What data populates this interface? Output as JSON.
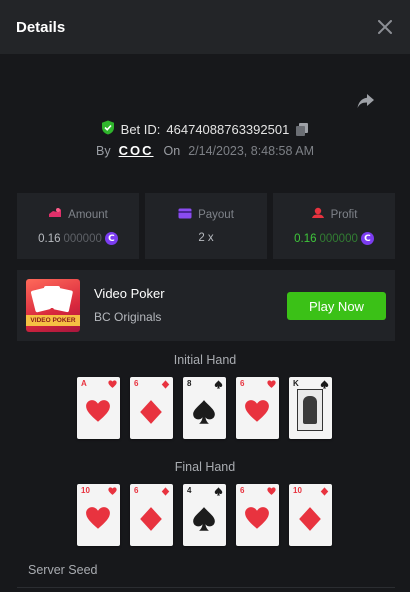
{
  "header": {
    "title": "Details"
  },
  "bet": {
    "label": "Bet ID:",
    "id": "46474088763392501",
    "by_label": "By",
    "user": "COC",
    "on_label": "On",
    "date": "2/14/2023, 8:48:58 AM"
  },
  "stats": {
    "amount": {
      "label": "Amount",
      "value_main": "0.16",
      "value_dim": "000000"
    },
    "payout": {
      "label": "Payout",
      "value": "2 x"
    },
    "profit": {
      "label": "Profit",
      "value_main": "0.16",
      "value_dim": "000000"
    }
  },
  "game": {
    "name": "Video Poker",
    "provider": "BC Originals",
    "play_label": "Play Now",
    "thumb_text": "VIDEO POKER"
  },
  "initial_hand": {
    "label": "Initial Hand",
    "cards": [
      {
        "rank": "A",
        "suit": "hearts"
      },
      {
        "rank": "6",
        "suit": "diamonds"
      },
      {
        "rank": "8",
        "suit": "spades"
      },
      {
        "rank": "6",
        "suit": "hearts"
      },
      {
        "rank": "K",
        "suit": "spades"
      }
    ]
  },
  "final_hand": {
    "label": "Final Hand",
    "cards": [
      {
        "rank": "10",
        "suit": "hearts"
      },
      {
        "rank": "6",
        "suit": "diamonds"
      },
      {
        "rank": "4",
        "suit": "spades"
      },
      {
        "rank": "6",
        "suit": "hearts"
      },
      {
        "rank": "10",
        "suit": "diamonds"
      }
    ]
  },
  "server_seed": {
    "label": "Server Seed"
  },
  "colors": {
    "accent_green": "#3bc117",
    "profit_green": "#3fc63b",
    "coin_purple": "#7b3cf0",
    "card_red": "#e8333f"
  }
}
